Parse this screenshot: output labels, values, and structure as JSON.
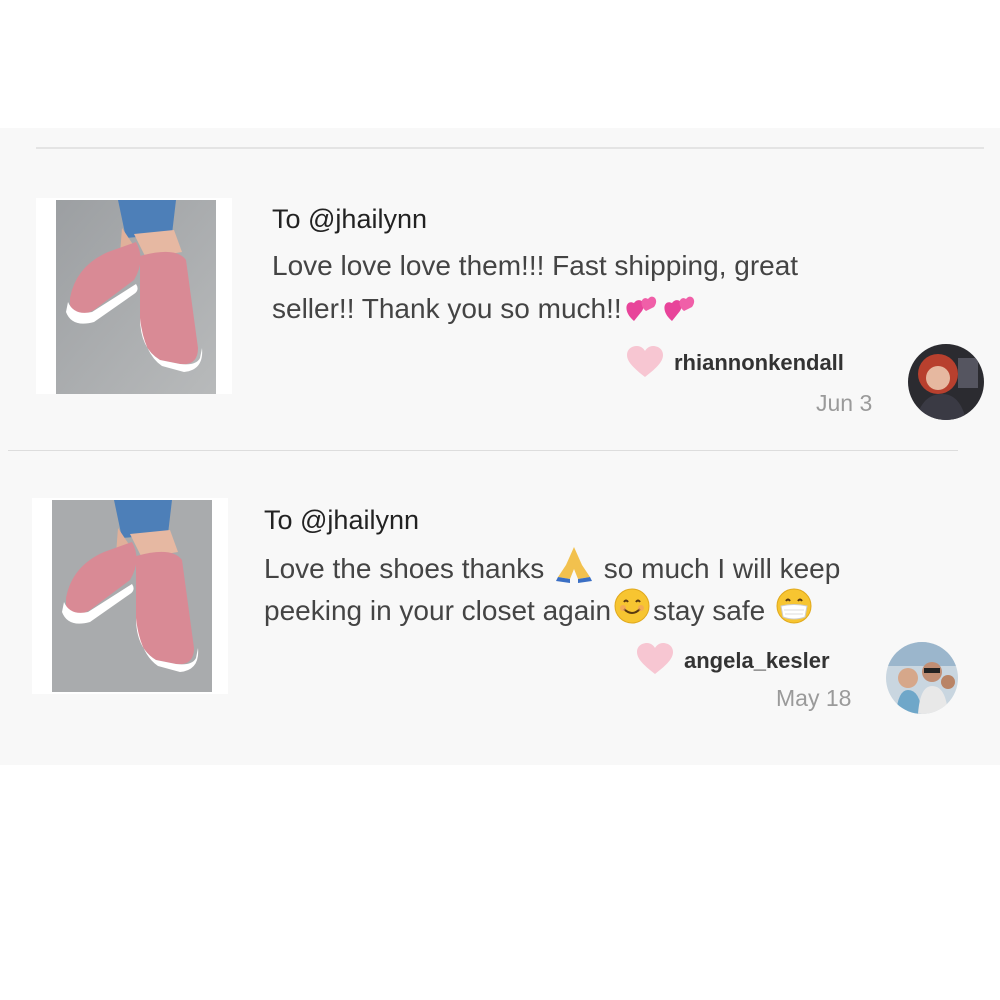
{
  "reviews": [
    {
      "to": "To @jhailynn",
      "message_line1": "Love love love them!!! Fast shipping, great",
      "message_line2_text": "seller!! Thank you so much!!",
      "message_line2_emojis": [
        "revolving-hearts",
        "revolving-hearts"
      ],
      "username": "rhiannonkendall",
      "date": "Jun 3",
      "product_image": "pink-slip-on-sneakers",
      "avatar": "user-avatar"
    },
    {
      "to": "To @jhailynn",
      "message_line1_a": "Love the shoes thanks",
      "message_line1_emoji": "folded-hands",
      "message_line1_b": "so much I will keep",
      "message_line2_a": "peeking in your closet again",
      "message_line2_emoji1": "smiling-face",
      "message_line2_b": "stay safe",
      "message_line2_emoji2": "face-with-medical-mask",
      "username": "angela_kesler",
      "date": "May 18",
      "product_image": "pink-slip-on-sneakers",
      "avatar": "user-avatar"
    }
  ],
  "colors": {
    "heart": "#f7c6d2",
    "panel_bg": "#f8f8f8",
    "shoe_pink": "#d98a95",
    "date_gray": "#9a9a9a"
  }
}
